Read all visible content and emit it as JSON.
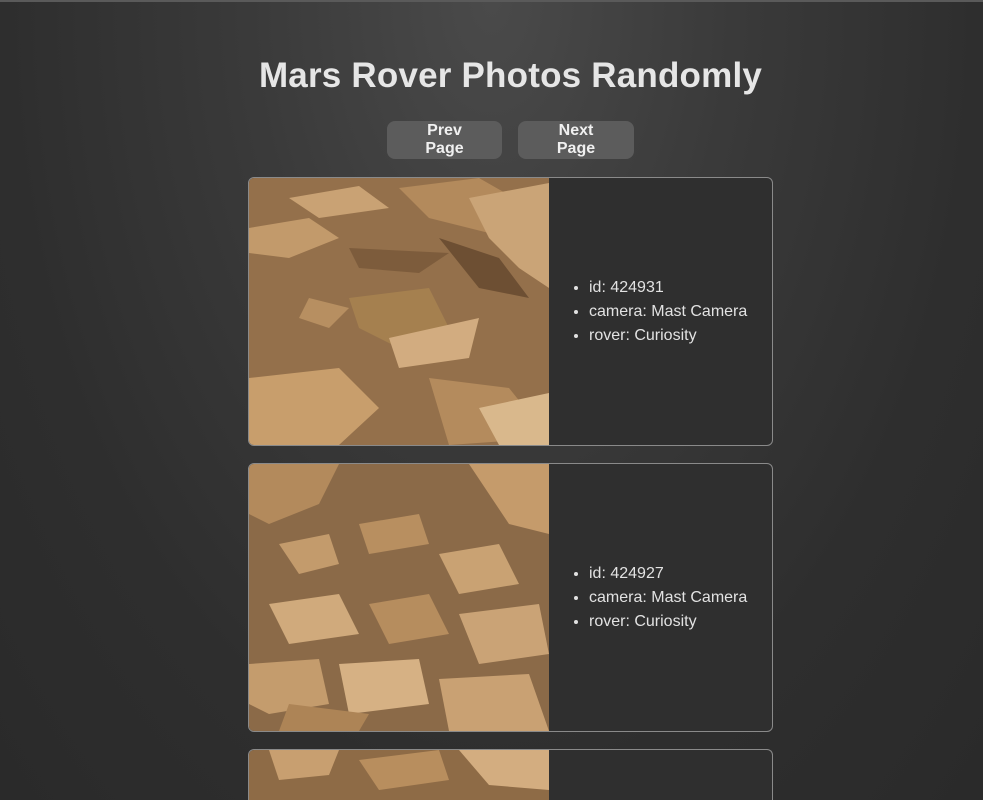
{
  "header": {
    "title": "Mars Rover Photos Randomly"
  },
  "nav": {
    "prev_label": "Prev Page",
    "next_label": "Next Page"
  },
  "photos": [
    {
      "id": "id: 424931",
      "camera": "camera: Mast Camera",
      "rover": "rover: Curiosity"
    },
    {
      "id": "id: 424927",
      "camera": "camera: Mast Camera",
      "rover": "rover: Curiosity"
    },
    {
      "id": "",
      "camera": "",
      "rover": ""
    }
  ]
}
